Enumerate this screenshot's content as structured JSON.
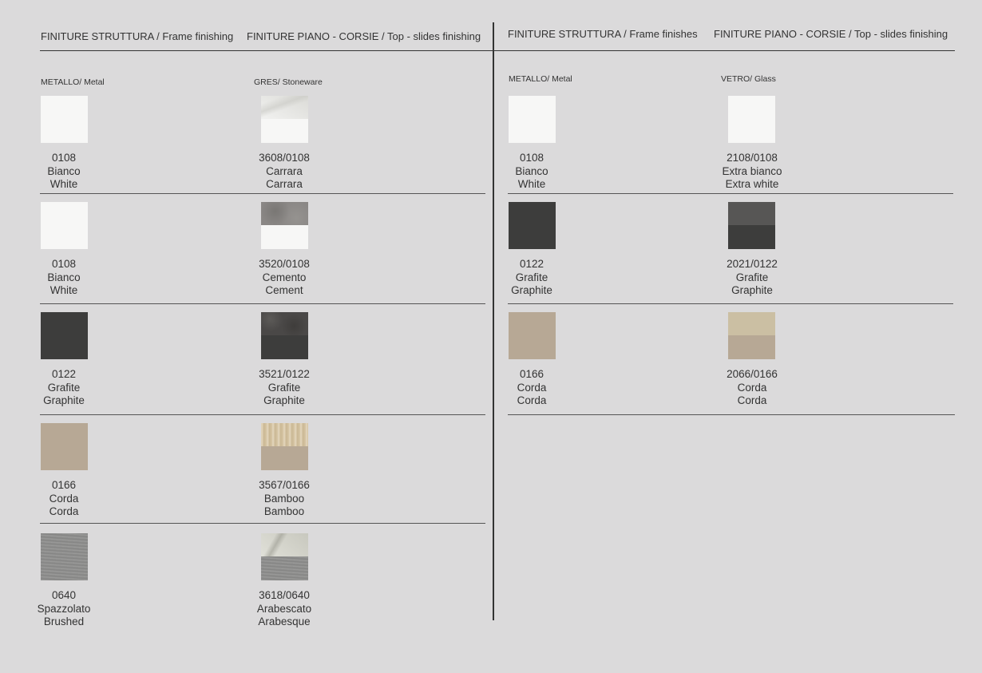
{
  "left": {
    "header_frame": "FINITURE STRUTTURA / Frame finishing",
    "header_top": "FINITURE PIANO - CORSIE / Top - slides finishing",
    "sub_frame": "METALLO/ Metal",
    "sub_top": "GRES/ Stoneware",
    "rows": [
      {
        "frame": {
          "code": "0108",
          "it": "Bianco",
          "en": "White",
          "color": "#f7f7f6"
        },
        "top": {
          "code": "3608/0108",
          "it": "Carrara",
          "en": "Carrara",
          "top_color": "#e4e4e1",
          "bottom_color": "#f7f7f6",
          "texture": "marble"
        }
      },
      {
        "frame": {
          "code": "0108",
          "it": "Bianco",
          "en": "White",
          "color": "#f7f7f6"
        },
        "top": {
          "code": "3520/0108",
          "it": "Cemento",
          "en": "Cement",
          "top_color": "#8a8785",
          "bottom_color": "#f7f7f6",
          "texture": "cement"
        }
      },
      {
        "frame": {
          "code": "0122",
          "it": "Grafite",
          "en": "Graphite",
          "color": "#3d3d3c"
        },
        "top": {
          "code": "3521/0122",
          "it": "Grafite",
          "en": "Graphite",
          "top_color": "#4a4847",
          "bottom_color": "#3d3d3c",
          "texture": "stone"
        }
      },
      {
        "frame": {
          "code": "0166",
          "it": "Corda",
          "en": "Corda",
          "color": "#b7a895"
        },
        "top": {
          "code": "3567/0166",
          "it": "Bamboo",
          "en": "Bamboo",
          "top_color": "#d8c7a6",
          "bottom_color": "#b7a895",
          "texture": "bamboo"
        }
      },
      {
        "frame": {
          "code": "0640",
          "it": "Spazzolato",
          "en": "Brushed",
          "color": "#8f8f8e",
          "texture": "brushed"
        },
        "top": {
          "code": "3618/0640",
          "it": "Arabescato",
          "en": "Arabesque",
          "top_color": "#cfcfc6",
          "bottom_color": "#8f8f8e",
          "texture": "arabesque"
        }
      }
    ]
  },
  "right": {
    "header_frame": "FINITURE STRUTTURA / Frame finishes",
    "header_top": "FINITURE PIANO - CORSIE / Top - slides finishing",
    "sub_frame": "METALLO/ Metal",
    "sub_top": "VETRO/ Glass",
    "rows": [
      {
        "frame": {
          "code": "0108",
          "it": "Bianco",
          "en": "White",
          "color": "#f7f7f6"
        },
        "top": {
          "code": "2108/0108",
          "it": "Extra bianco",
          "en": "Extra white",
          "top_color": "#f7f7f6",
          "bottom_color": "#f7f7f6"
        }
      },
      {
        "frame": {
          "code": "0122",
          "it": "Grafite",
          "en": "Graphite",
          "color": "#3d3d3c"
        },
        "top": {
          "code": "2021/0122",
          "it": "Grafite",
          "en": "Graphite",
          "top_color": "#575655",
          "bottom_color": "#3d3d3c"
        }
      },
      {
        "frame": {
          "code": "0166",
          "it": "Corda",
          "en": "Corda",
          "color": "#b7a895"
        },
        "top": {
          "code": "2066/0166",
          "it": "Corda",
          "en": "Corda",
          "top_color": "#cbbfa3",
          "bottom_color": "#b7a895"
        }
      }
    ]
  }
}
